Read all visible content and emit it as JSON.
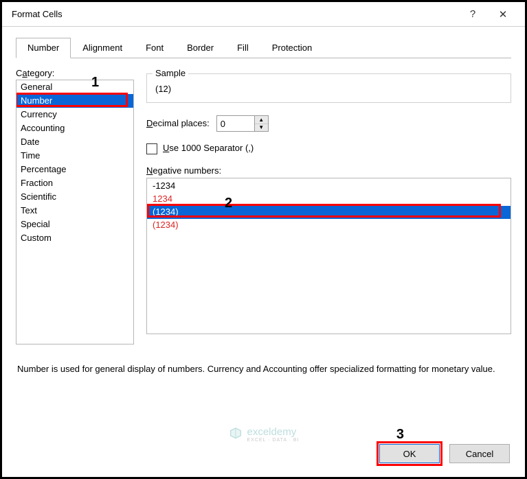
{
  "dialog": {
    "title": "Format Cells",
    "help_glyph": "?",
    "close_glyph": "✕"
  },
  "tabs": [
    {
      "label": "Number",
      "active": true
    },
    {
      "label": "Alignment",
      "active": false
    },
    {
      "label": "Font",
      "active": false
    },
    {
      "label": "Border",
      "active": false
    },
    {
      "label": "Fill",
      "active": false
    },
    {
      "label": "Protection",
      "active": false
    }
  ],
  "category": {
    "label_pre": "C",
    "label_ul": "a",
    "label_post": "tegory:",
    "items": [
      "General",
      "Number",
      "Currency",
      "Accounting",
      "Date",
      "Time",
      "Percentage",
      "Fraction",
      "Scientific",
      "Text",
      "Special",
      "Custom"
    ],
    "selected_index": 1
  },
  "sample": {
    "legend": "Sample",
    "value": "(12)"
  },
  "decimal": {
    "label_ul": "D",
    "label_post": "ecimal places:",
    "value": "0"
  },
  "separator": {
    "label_ul": "U",
    "label_post": "se 1000 Separator (,)",
    "checked": false
  },
  "negative": {
    "label_ul": "N",
    "label_post": "egative numbers:",
    "items": [
      {
        "text": "-1234",
        "red": false
      },
      {
        "text": "1234",
        "red": true
      },
      {
        "text": "(1234)",
        "red": false,
        "selected": true
      },
      {
        "text": "(1234)",
        "red": true
      }
    ]
  },
  "description": "Number is used for general display of numbers.  Currency and Accounting offer specialized formatting for monetary value.",
  "buttons": {
    "ok": "OK",
    "cancel": "Cancel"
  },
  "annotations": {
    "a1": "1",
    "a2": "2",
    "a3": "3"
  },
  "watermark": {
    "brand": "exceldemy",
    "sub": "EXCEL · DATA · BI"
  }
}
